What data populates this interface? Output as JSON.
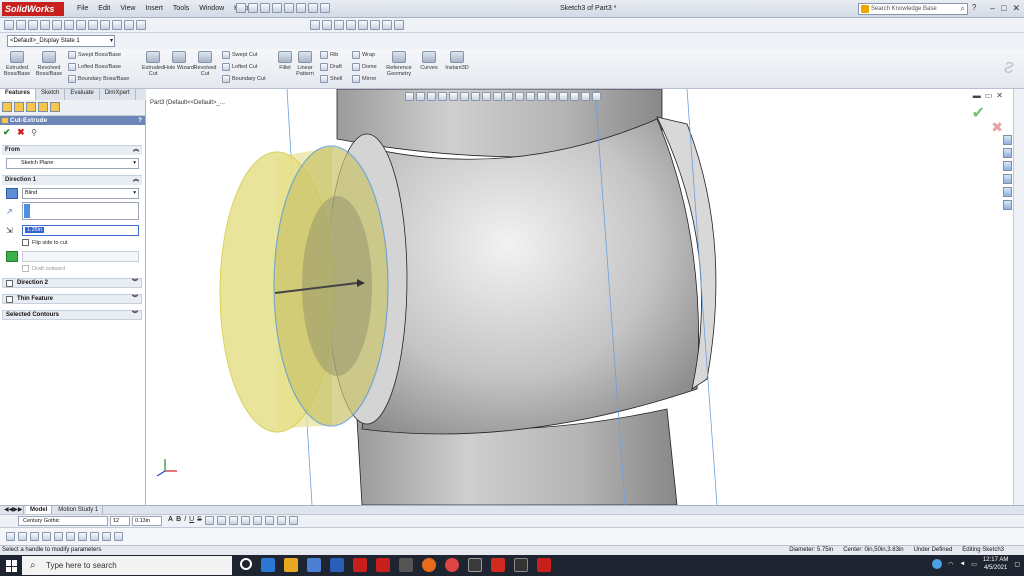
{
  "app": {
    "logo_text": "SolidWorks",
    "menus": [
      "File",
      "Edit",
      "View",
      "Insert",
      "Tools",
      "Window",
      "Help"
    ],
    "doc_title": "Sketch3 of Part3 *",
    "search_placeholder": "Search Knowledge Base",
    "help_label": "?",
    "window_controls": [
      "–",
      "□",
      "✕"
    ]
  },
  "config": {
    "display_state": "<Default>_Display State 1"
  },
  "ribbon": {
    "big_buttons": [
      {
        "label": "Extruded Boss/Base",
        "icon": "extrude-icon"
      },
      {
        "label": "Revolved Boss/Base",
        "icon": "revolve-icon"
      },
      {
        "label": "Extruded Cut",
        "icon": "extruded-cut-icon"
      },
      {
        "label": "Hole Wizard",
        "icon": "hole-wizard-icon"
      },
      {
        "label": "Revolved Cut",
        "icon": "revolved-cut-icon"
      },
      {
        "label": "Fillet",
        "icon": "fillet-icon"
      },
      {
        "label": "Linear Pattern",
        "icon": "linear-pattern-icon"
      },
      {
        "label": "Reference Geometry",
        "icon": "reference-geometry-icon"
      },
      {
        "label": "Curves",
        "icon": "curves-icon"
      },
      {
        "label": "Instant3D",
        "icon": "instant3d-icon"
      }
    ],
    "small_col1": [
      "Swept Boss/Base",
      "Lofted Boss/Base",
      "Boundary Boss/Base"
    ],
    "small_col2": [
      "Swept Cut",
      "Lofted Cut",
      "Boundary Cut"
    ],
    "small_col3": [
      "Rib",
      "Draft",
      "Shell"
    ],
    "small_col4": [
      "Wrap",
      "Dome",
      "Mirror"
    ]
  },
  "panel_tabs": [
    "Features",
    "Sketch",
    "Evaluate",
    "DimXpert"
  ],
  "property_manager": {
    "title": "Cut-Extrude",
    "help": "?",
    "from": {
      "header": "From",
      "value": "Sketch Plane"
    },
    "direction1": {
      "header": "Direction 1",
      "end_condition": "Blind",
      "depth": "1.25in",
      "flip_label": "Flip side to cut",
      "draft_label": "Draft outward"
    },
    "direction2": "Direction 2",
    "thin_feature": "Thin Feature",
    "selected_contours": "Selected Contours"
  },
  "viewport": {
    "tree_label": "Part3 (Default<<Default>_..."
  },
  "bottom_tabs": [
    "Model",
    "Motion Study 1"
  ],
  "format_bar": {
    "font": "Century Gothic",
    "size": "12",
    "height": "0.13in"
  },
  "status": {
    "hint": "Select a handle to modify parameters",
    "diameter": "Diameter: 5.75in",
    "center": "Center: 0in,50in,3.83in",
    "state": "Under Defined",
    "editing": "Editing Sketch3"
  },
  "taskbar": {
    "search_placeholder": "Type here to search",
    "time": "12:17 AM",
    "date": "4/5/2021"
  },
  "colors": {
    "accent": "#6c86b8",
    "cut_preview": "#e6e08a",
    "edge_blue": "#4a90d9"
  }
}
